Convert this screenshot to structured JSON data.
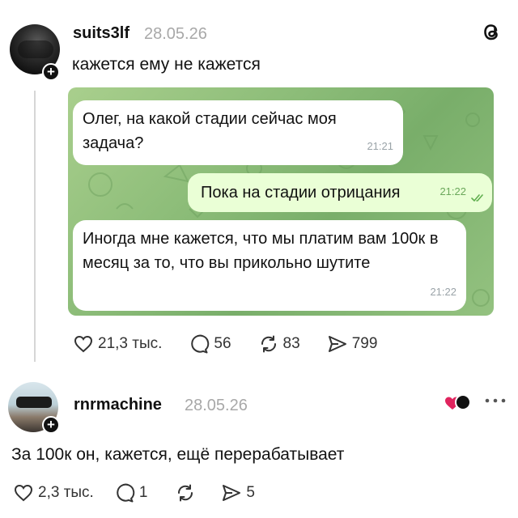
{
  "post1": {
    "username": "suits3lf",
    "timestamp": "28.05.26",
    "caption": "кажется ему не кажется",
    "chat": {
      "messages": [
        {
          "direction": "incoming",
          "text": "Олег, на какой стадии сейчас моя задача?",
          "time": "21:21"
        },
        {
          "direction": "outgoing",
          "text": "Пока на стадии отрицания",
          "time": "21:22"
        },
        {
          "direction": "incoming",
          "text": "Иногда мне кажется, что мы платим вам 100к в месяц за то, что вы прикольно шутите",
          "time": "21:22"
        }
      ]
    },
    "actions": {
      "likes": "21,3 тыс.",
      "replies": "56",
      "reposts": "83",
      "shares": "799"
    }
  },
  "post2": {
    "username": "rnrmachine",
    "timestamp": "28.05.26",
    "caption": "За 100к он, кажется, ещё перерабатывает",
    "actions": {
      "likes": "2,3 тыс.",
      "replies": "1",
      "reposts": "",
      "shares": "5"
    }
  },
  "icons": {
    "app_logo": "threads-logo-icon",
    "like": "heart-icon",
    "reply": "comment-bubble-icon",
    "repost": "repost-arrows-icon",
    "share": "send-icon",
    "more": "more-dots-icon",
    "follow": "plus-icon"
  },
  "colors": {
    "text": "#111111",
    "muted": "#a8a8a8",
    "chat_bg": "#8dbd79",
    "bubble_in": "#ffffff",
    "bubble_out": "#eaffd6",
    "heart": "#e0245e"
  }
}
